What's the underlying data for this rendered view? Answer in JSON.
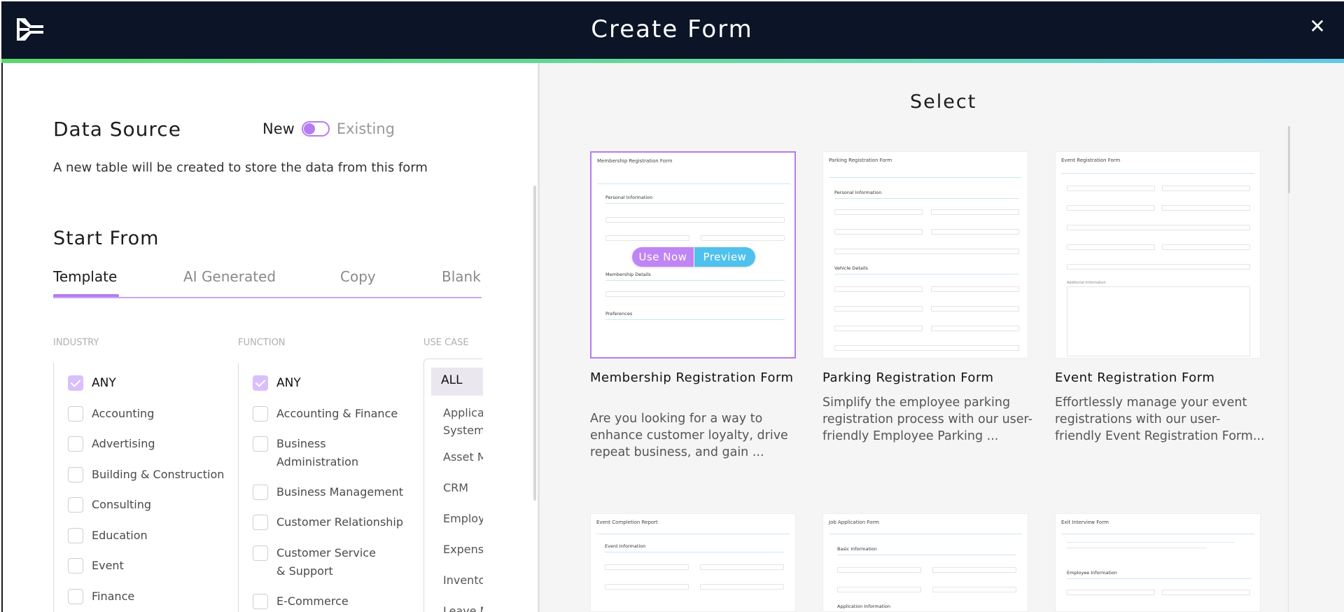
{
  "header": {
    "title": "Create Form",
    "close_icon": "close-icon",
    "logo": "app-logo"
  },
  "data_source": {
    "heading": "Data Source",
    "toggle_new": "New",
    "toggle_existing": "Existing",
    "toggle_state": "New",
    "description": "A new table will be created to store the data from this form"
  },
  "start_from": {
    "heading": "Start From",
    "tabs": [
      {
        "label": "Template",
        "active": true
      },
      {
        "label": "AI Generated",
        "active": false
      },
      {
        "label": "Copy",
        "active": false
      },
      {
        "label": "Blank",
        "active": false
      }
    ]
  },
  "filters": {
    "industry": {
      "heading": "INDUSTRY",
      "items": [
        {
          "label": "ANY",
          "checked": true
        },
        {
          "label": "Accounting",
          "checked": false
        },
        {
          "label": "Advertising",
          "checked": false
        },
        {
          "label": "Building & Construction",
          "checked": false
        },
        {
          "label": "Consulting",
          "checked": false
        },
        {
          "label": "Education",
          "checked": false
        },
        {
          "label": "Event",
          "checked": false
        },
        {
          "label": "Finance",
          "checked": false
        }
      ]
    },
    "function": {
      "heading": "FUNCTION",
      "items": [
        {
          "label": "ANY",
          "checked": true
        },
        {
          "label": "Accounting & Finance",
          "checked": false
        },
        {
          "label": "Business Administration",
          "checked": false
        },
        {
          "label": "Business Management",
          "checked": false
        },
        {
          "label": "Customer Relationship",
          "checked": false
        },
        {
          "label": "Customer Service & Support",
          "checked": false
        },
        {
          "label": "E-Commerce",
          "checked": false
        }
      ]
    },
    "use_case": {
      "heading": "USE CASE",
      "selected": "ALL",
      "items": [
        "Applica System",
        "Asset M",
        "CRM",
        "Employ",
        "Expens",
        "Invento",
        "Leave M"
      ]
    }
  },
  "select": {
    "heading": "Select",
    "use_now_label": "Use Now",
    "preview_label": "Preview",
    "cards": [
      {
        "title": "Membership Registration Form",
        "description": "Are you looking for a way to enhance customer loyalty, drive repeat business, and gain ...",
        "thumb_title": "Membership Registration Form",
        "sections": [
          "Personal Information",
          "Membership Details",
          "Preferences"
        ],
        "selected": true
      },
      {
        "title": "Parking Registration Form",
        "description": "Simplify the employee parking registration process with our user-friendly Employee Parking ...",
        "thumb_title": "Parking Registration Form",
        "sections": [
          "Personal Information",
          "Vehicle Details"
        ],
        "selected": false
      },
      {
        "title": "Event Registration Form",
        "description": "Effortlessly manage your event registrations with our user-friendly Event Registration Form...",
        "thumb_title": "Event Registration Form",
        "sections": [
          "Additional Information"
        ],
        "selected": false
      },
      {
        "thumb_title": "Event Completion Report",
        "sections": [
          "Event Information"
        ]
      },
      {
        "thumb_title": "Job Application Form",
        "sections": [
          "Basic Information",
          "Application Information"
        ]
      },
      {
        "thumb_title": "Exit Interview Form",
        "sections": [
          "Employee Information"
        ]
      }
    ]
  }
}
